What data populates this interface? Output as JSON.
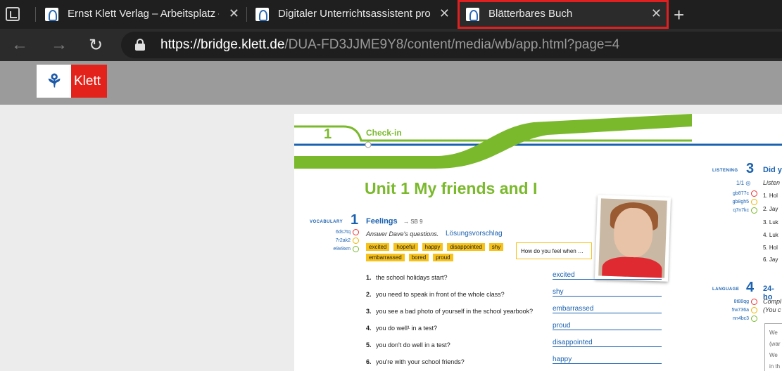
{
  "browser": {
    "tabs": [
      {
        "title": "Ernst Klett Verlag – Arbeitsplatz –",
        "active": false
      },
      {
        "title": "Digitaler Unterrichtsassistent pro",
        "active": false
      },
      {
        "title": "Blätterbares Buch",
        "active": true
      }
    ],
    "url_scheme": "https://",
    "url_host": "bridge.klett.de",
    "url_path": "/DUA-FD3JJME9Y8/content/media/wb/app.html?page=4"
  },
  "site": {
    "logo_text": "Klett",
    "brand_color": "#e3231b"
  },
  "page": {
    "banner_number": "1",
    "banner_label": "Check-in",
    "unit_title": "Unit 1    My friends and I",
    "ex1": {
      "section": "VOCABULARY",
      "number": "1",
      "title": "Feelings",
      "ref": "→  SB 9",
      "codes": [
        "6ds7tq",
        "7r2ak2",
        "e9x9xm"
      ],
      "instruction": "Answer Dave's questions.",
      "solution_link": "Lösungsvorschlag",
      "chips": [
        "excited",
        "hopeful",
        "happy",
        "disappointed",
        "shy",
        "embarrassed",
        "bored",
        "proud"
      ],
      "speech_bubble": "How do you feel when …",
      "questions": [
        {
          "n": "1.",
          "text": "the school holidays start?",
          "answer": "excited"
        },
        {
          "n": "2.",
          "text": "you need to speak in front of the whole class?",
          "answer": "shy"
        },
        {
          "n": "3.",
          "text": "you see a bad photo of yourself in the school yearbook?",
          "answer": "embarrassed"
        },
        {
          "n": "4.",
          "text": "you do well¹ in a test?",
          "answer": "proud"
        },
        {
          "n": "5.",
          "text": "you don't do well in a test?",
          "answer": "disappointed"
        },
        {
          "n": "6.",
          "text": "you're with your school friends?",
          "answer": "happy"
        }
      ]
    },
    "ex3": {
      "section": "LISTENING",
      "number": "3",
      "title": "Did y",
      "track": "1/1 ◎",
      "instruction": "Listen",
      "codes": [
        "gb877c",
        "gb8gh5",
        "q7n7kc"
      ],
      "lines": [
        "1.  Hol",
        "2.  Jay",
        "3.  Luk",
        "4.  Luk",
        "5.  Hol",
        "6.  Jay"
      ]
    },
    "ex4": {
      "section": "LANGUAGE",
      "number": "4",
      "title": "24-ho",
      "instruction": "Compl",
      "instruction2": "(You c",
      "codes": [
        "8t88qg",
        "5w736a",
        "nn4bc3"
      ],
      "box_lines": [
        "We",
        "(war",
        "We",
        "in th"
      ]
    }
  }
}
